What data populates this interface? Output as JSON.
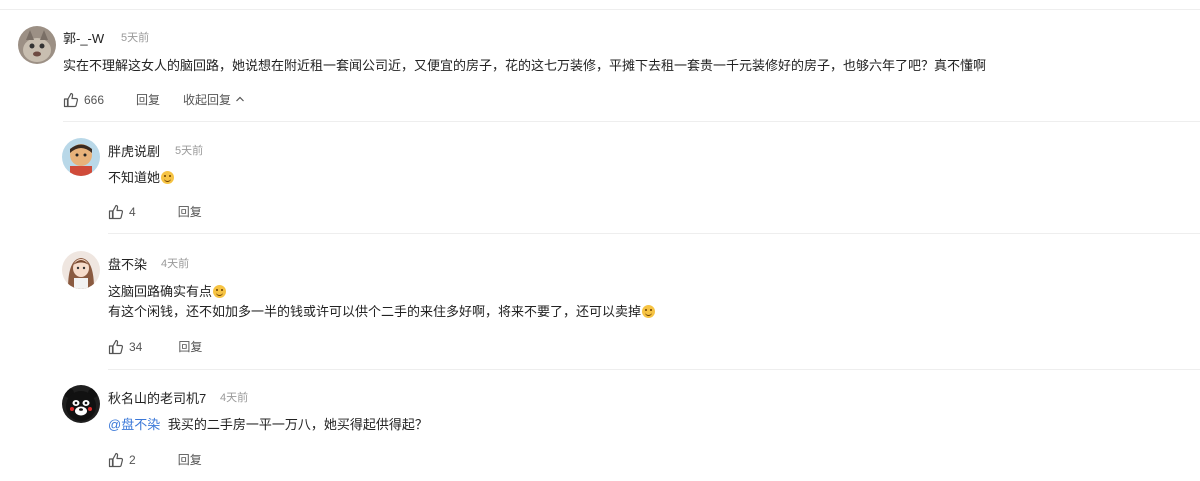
{
  "comments": [
    {
      "user": "郭-_-W",
      "time": "5天前",
      "text": "实在不理解这女人的脑回路，她说想在附近租一套闻公司近，又便宜的房子，花的这七万装修，平摊下去租一套贵一千元装修好的房子，也够六年了吧？真不懂啊",
      "likes": "666",
      "reply_label": "回复",
      "collapse_label": "收起回复"
    }
  ],
  "replies": [
    {
      "user": "胖虎说剧",
      "time": "5天前",
      "text": "不知道她",
      "likes": "4",
      "reply_label": "回复"
    },
    {
      "user": "盘不染",
      "time": "4天前",
      "line1": "这脑回路确实有点",
      "line2": "有这个闲钱，还不如加多一半的钱或许可以供个二手的来住多好啊，将来不要了，还可以卖掉",
      "likes": "34",
      "reply_label": "回复"
    },
    {
      "user": "秋名山的老司机7",
      "time": "4天前",
      "mention": "@盘不染",
      "text": "我买的二手房一平一万八，她买得起供得起？",
      "likes": "2",
      "reply_label": "回复"
    }
  ],
  "icons": {
    "like": "thumbs-up-icon",
    "chevron": "chevron-up-icon",
    "emoji": "smile-emoji-icon"
  },
  "colors": {
    "mention": "#3b78d8",
    "meta": "#999999",
    "text": "#222222"
  }
}
